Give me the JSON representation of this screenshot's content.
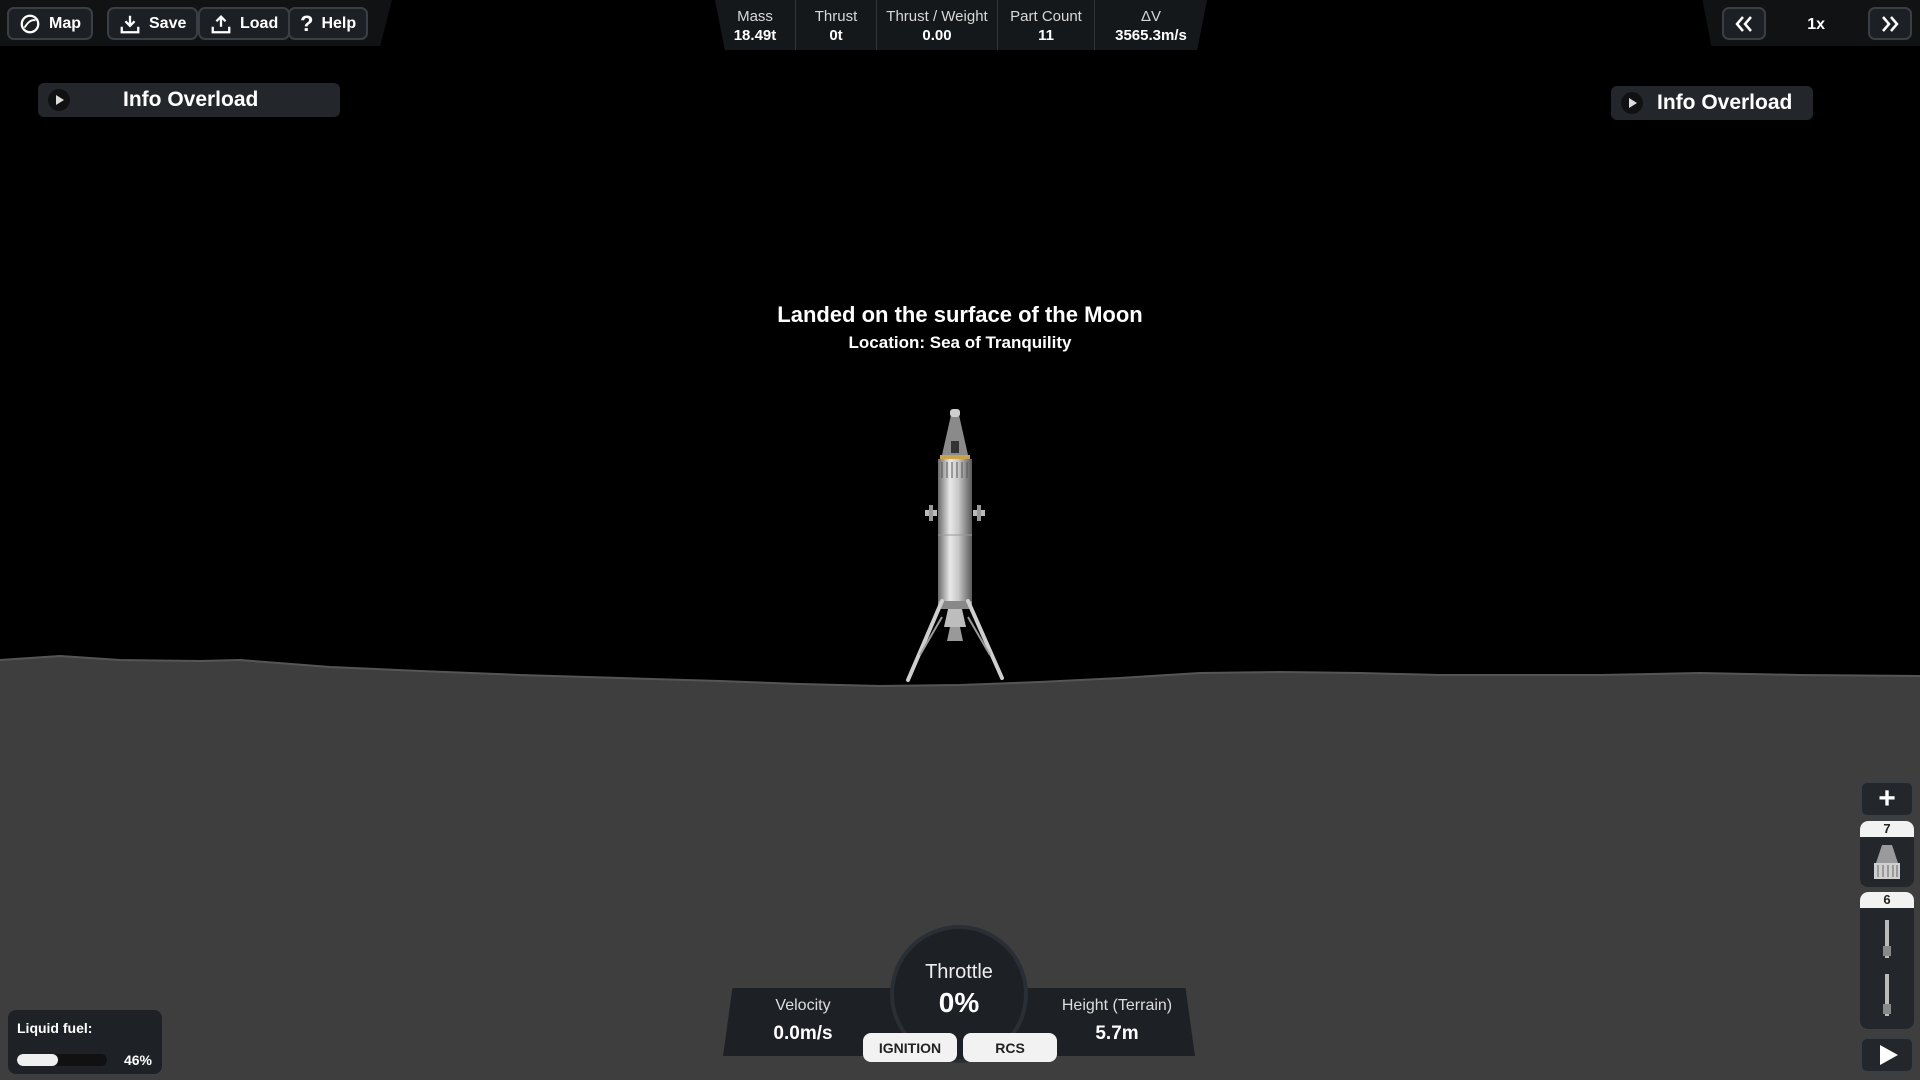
{
  "toolbar": {
    "map_label": "Map",
    "save_label": "Save",
    "load_label": "Load",
    "help_label": "Help"
  },
  "stats": {
    "mass": {
      "label": "Mass",
      "value": "18.49t"
    },
    "thrust": {
      "label": "Thrust",
      "value": "0t"
    },
    "twr": {
      "label": "Thrust / Weight",
      "value": "0.00"
    },
    "parts": {
      "label": "Part Count",
      "value": "11"
    },
    "dv": {
      "label": "ΔV",
      "value": "3565.3m/s"
    }
  },
  "time": {
    "rewind_icon": "double-chevron-left-icon",
    "speed": "1x",
    "forward_icon": "double-chevron-right-icon"
  },
  "info_left": {
    "label": "Info Overload"
  },
  "info_right": {
    "label": "Info Overload"
  },
  "message": {
    "title": "Landed on the surface of the Moon",
    "location": "Location: Sea of Tranquility"
  },
  "stages": [
    {
      "number": "7"
    },
    {
      "number": "6"
    }
  ],
  "fuel": {
    "label": "Liquid fuel:",
    "percent_text": "46%",
    "fraction": 0.46
  },
  "hud": {
    "velocity_label": "Velocity",
    "velocity_value": "0.0m/s",
    "throttle_label": "Throttle",
    "throttle_value": "0%",
    "height_label": "Height (Terrain)",
    "height_value": "5.7m",
    "ignition_label": "IGNITION",
    "rcs_label": "RCS"
  },
  "colors": {
    "sky": "#000000",
    "ground": "#3e3e3e",
    "panel": "#1d2126"
  }
}
